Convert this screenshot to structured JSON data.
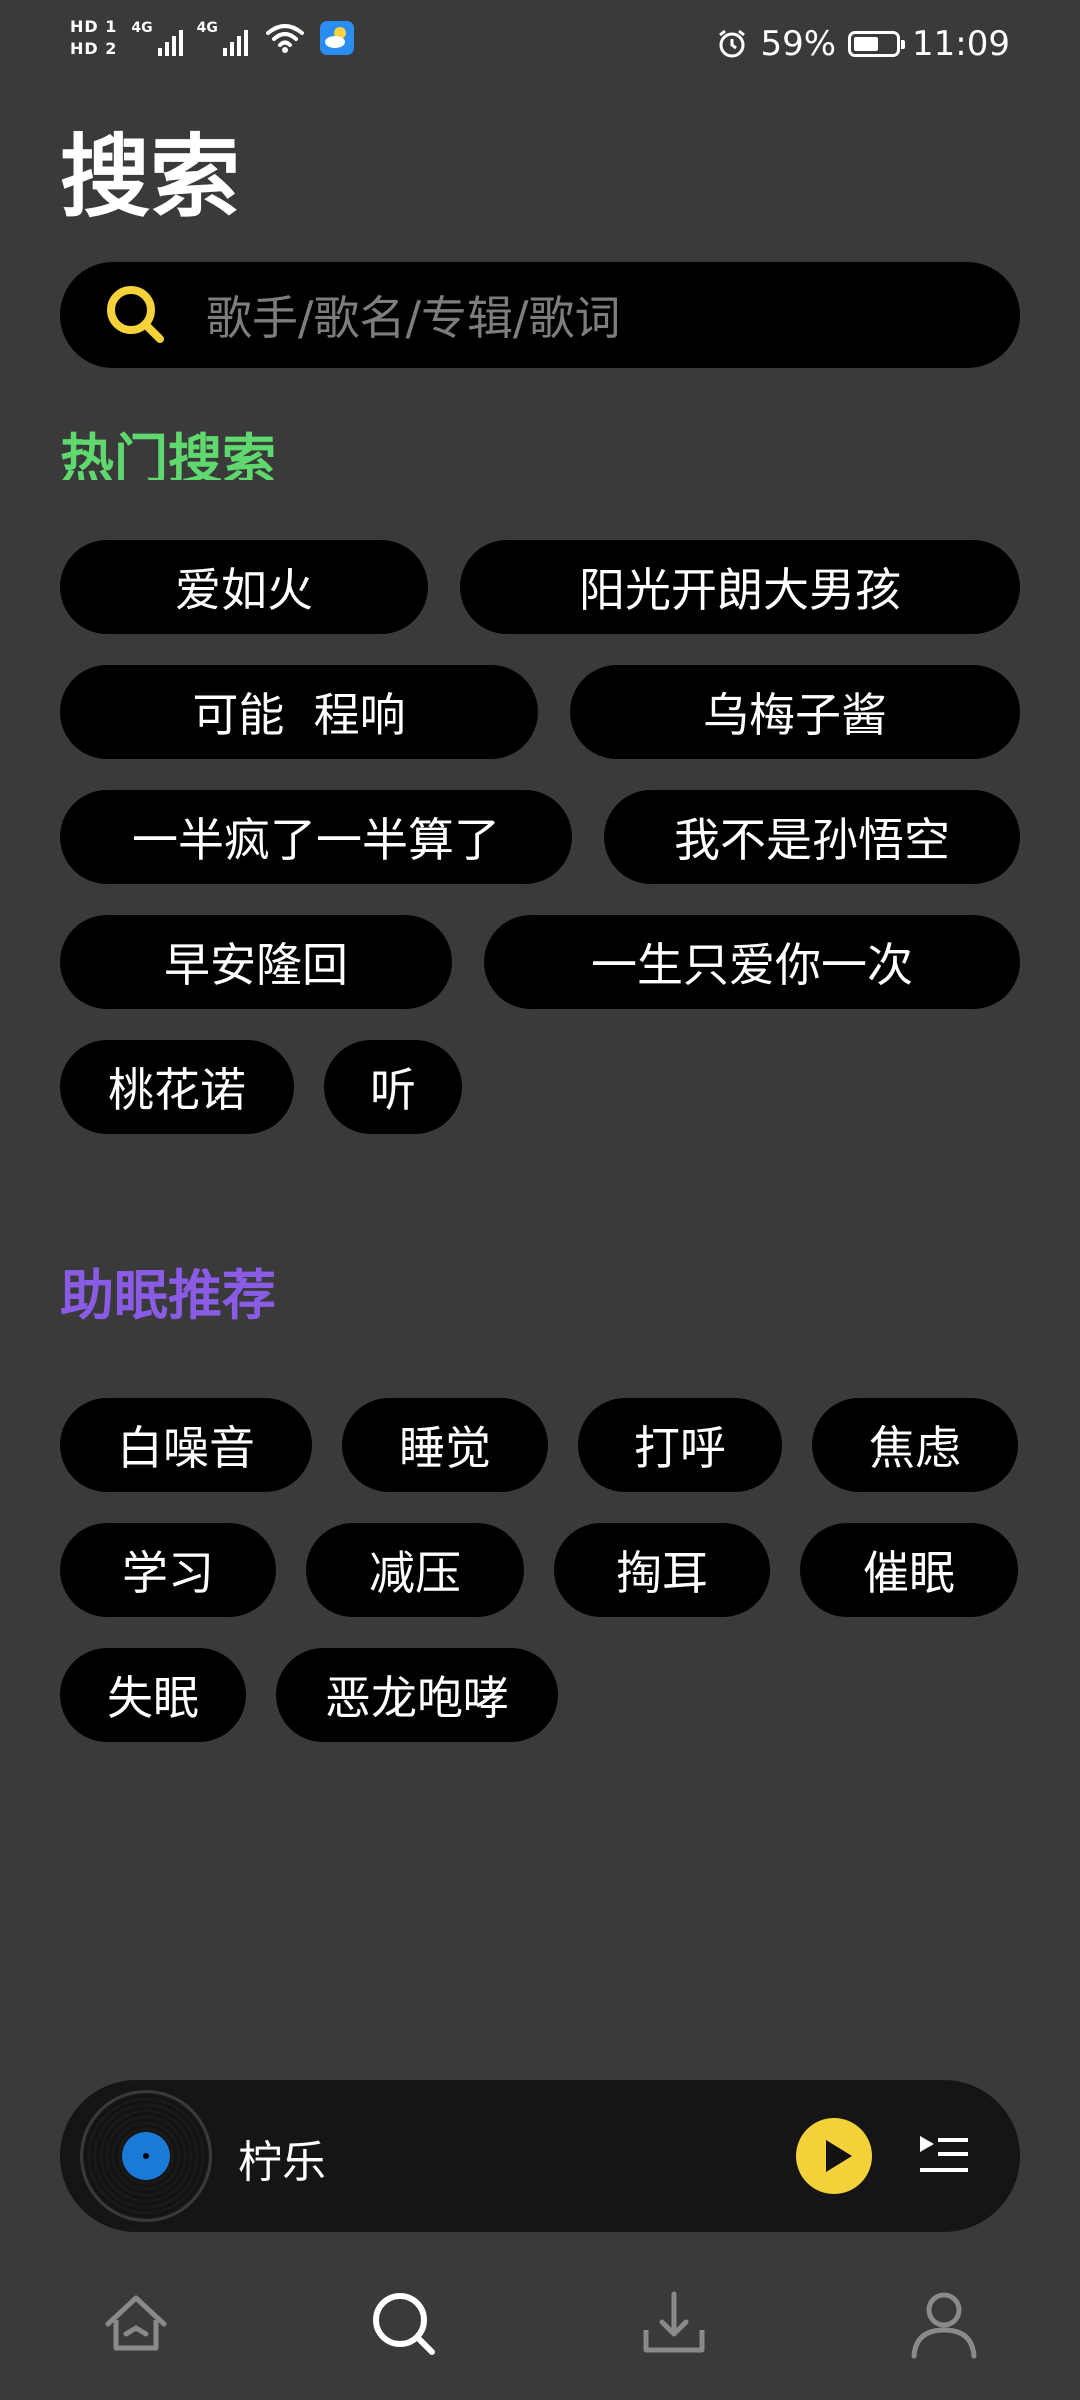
{
  "status_bar": {
    "sim1": "HD 1",
    "sim2": "HD 2",
    "network1": "4G",
    "network2": "4G",
    "battery": "59%",
    "time": "11:09",
    "icons": [
      "wifi-icon",
      "weather-app-icon",
      "alarm-icon",
      "battery-icon"
    ]
  },
  "page": {
    "title": "搜索"
  },
  "search": {
    "placeholder": "歌手/歌名/专辑/歌词"
  },
  "hot_search": {
    "title": "热门搜索",
    "items": [
      "爱如火",
      "阳光开朗大男孩",
      "可能  程响",
      "乌梅子酱",
      "一半疯了一半算了",
      "我不是孙悟空",
      "早安隆回",
      "一生只爱你一次",
      "桃花诺",
      "听"
    ]
  },
  "sleep_recommend": {
    "title": "助眠推荐",
    "items": [
      "白噪音",
      "睡觉",
      "打呼",
      "焦虑",
      "学习",
      "减压",
      "掏耳",
      "催眠",
      "失眠",
      "恶龙咆哮"
    ]
  },
  "player": {
    "track": "柠乐"
  },
  "bottom_nav": {
    "items": [
      "home-icon",
      "search-icon",
      "download-icon",
      "profile-icon"
    ],
    "active": "search"
  },
  "colors": {
    "background": "#3a3a3b",
    "hot_title": "#5fd86e",
    "sleep_title": "#8a5ce6",
    "accent": "#f5d23a"
  }
}
